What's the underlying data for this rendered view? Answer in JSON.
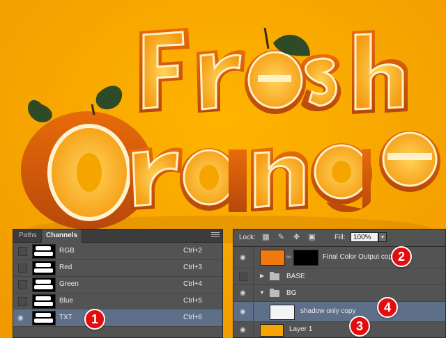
{
  "colors": {
    "background": "#f6a600",
    "panel": "#535353",
    "selected_row": "#5e6f89",
    "badge": "#e30d0d"
  },
  "channels_panel": {
    "tabs": [
      {
        "label": "Paths",
        "active": false
      },
      {
        "label": "Channels",
        "active": true
      }
    ],
    "channels": [
      {
        "name": "RGB",
        "shortcut": "Ctrl+2",
        "visible": false,
        "selected": false
      },
      {
        "name": "Red",
        "shortcut": "Ctrl+3",
        "visible": false,
        "selected": false
      },
      {
        "name": "Green",
        "shortcut": "Ctrl+4",
        "visible": false,
        "selected": false
      },
      {
        "name": "Blue",
        "shortcut": "Ctrl+5",
        "visible": false,
        "selected": false
      },
      {
        "name": "TXT",
        "shortcut": "Ctrl+6",
        "visible": true,
        "selected": true
      }
    ]
  },
  "layers_panel": {
    "lock_label": "Lock:",
    "fill_label": "Fill:",
    "fill_value": "100%",
    "layers": [
      {
        "name": "Final Color Output copy",
        "type": "smart-masked",
        "visible": true
      },
      {
        "name": "BASE",
        "type": "group-collapsed",
        "visible": false
      },
      {
        "name": "BG",
        "type": "group-expanded",
        "visible": true
      },
      {
        "name": "shadow only copy",
        "type": "layer",
        "visible": true,
        "selected": true
      },
      {
        "name": "Layer 1",
        "type": "layer",
        "visible": true
      }
    ]
  },
  "badges": [
    "1",
    "2",
    "3",
    "4"
  ],
  "icons": [
    "eye-icon",
    "panel-menu-icon",
    "lock-transparent-icon",
    "lock-brush-icon",
    "lock-move-icon",
    "lock-all-icon",
    "folder-icon",
    "chain-icon",
    "dropdown-arrow-icon"
  ]
}
